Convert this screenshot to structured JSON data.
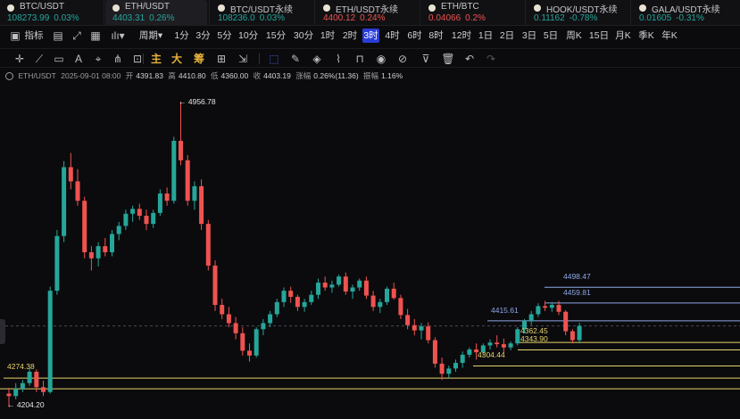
{
  "tickers": [
    {
      "name": "BTC/USDT",
      "price": "108273.99",
      "change": "0.03%",
      "dir": "up"
    },
    {
      "name": "ETH/USDT",
      "price": "4403.31",
      "change": "0.26%",
      "dir": "up",
      "active": true
    },
    {
      "name": "BTC/USDT永续",
      "price": "108236.0",
      "change": "0.03%",
      "dir": "up"
    },
    {
      "name": "ETH/USDT永续",
      "price": "4400.12",
      "change": "0.24%",
      "dir": "down"
    },
    {
      "name": "ETH/BTC",
      "price": "0.04066",
      "change": "0.2%",
      "dir": "down"
    },
    {
      "name": "HOOK/USDT永续",
      "price": "0.11162",
      "change": "-0.78%",
      "dir": "up"
    },
    {
      "name": "GALA/USDT永续",
      "price": "0.01605",
      "change": "-0.31%",
      "dir": "up"
    }
  ],
  "toolbar": {
    "indicator_label": "指标",
    "period_label": "周期",
    "periods": [
      "1分",
      "3分",
      "5分",
      "10分",
      "15分",
      "30分",
      "1时",
      "2时",
      "3时",
      "4时",
      "6时",
      "8时",
      "12时",
      "1日",
      "2日",
      "3日",
      "5日",
      "周K",
      "15日",
      "月K",
      "季K",
      "年K"
    ],
    "selected_period": "3时"
  },
  "drawing_toolbar": {
    "main_label": "主",
    "big_label": "大",
    "chips_label": "筹"
  },
  "info": {
    "symbol": "ETH/USDT",
    "time": "2025-09-01 08:00",
    "open_label": "开",
    "open": "4391.83",
    "high_label": "高",
    "high": "4410.80",
    "low_label": "低",
    "low": "4360.00",
    "close_label": "收",
    "close": "4403.19",
    "change_label": "涨幅",
    "change": "0.26%(11.36)",
    "amplitude_label": "振幅",
    "amplitude": "1.16%"
  },
  "chart_labels": {
    "high_marker": "← 4956.78",
    "low_marker": "← 4204.20",
    "levels": [
      "4498.47",
      "4459.81",
      "4415.61",
      "4362.45",
      "4343.90",
      "4304.44",
      "4274.38"
    ]
  },
  "chart_data": {
    "type": "candlestick",
    "price_max": 4956.78,
    "price_min": 4204.2,
    "candles": [
      [
        4236,
        4250,
        4204.2,
        4230
      ],
      [
        4230,
        4262,
        4222,
        4248
      ],
      [
        4248,
        4270,
        4240,
        4262
      ],
      [
        4262,
        4300,
        4255,
        4290
      ],
      [
        4290,
        4296,
        4240,
        4252
      ],
      [
        4252,
        4268,
        4230,
        4240
      ],
      [
        4240,
        4500,
        4236,
        4490
      ],
      [
        4490,
        4640,
        4480,
        4625
      ],
      [
        4625,
        4810,
        4610,
        4795
      ],
      [
        4795,
        4830,
        4740,
        4760
      ],
      [
        4760,
        4790,
        4700,
        4712
      ],
      [
        4712,
        4722,
        4570,
        4585
      ],
      [
        4585,
        4600,
        4540,
        4570
      ],
      [
        4570,
        4610,
        4550,
        4600
      ],
      [
        4600,
        4620,
        4575,
        4585
      ],
      [
        4585,
        4640,
        4575,
        4630
      ],
      [
        4630,
        4660,
        4615,
        4650
      ],
      [
        4650,
        4690,
        4640,
        4680
      ],
      [
        4680,
        4700,
        4660,
        4692
      ],
      [
        4692,
        4705,
        4665,
        4675
      ],
      [
        4675,
        4690,
        4640,
        4655
      ],
      [
        4655,
        4690,
        4645,
        4682
      ],
      [
        4682,
        4740,
        4675,
        4730
      ],
      [
        4730,
        4745,
        4700,
        4712
      ],
      [
        4712,
        4870,
        4705,
        4860
      ],
      [
        4860,
        4956.78,
        4800,
        4812
      ],
      [
        4812,
        4825,
        4700,
        4712
      ],
      [
        4712,
        4760,
        4690,
        4748
      ],
      [
        4748,
        4765,
        4640,
        4655
      ],
      [
        4655,
        4665,
        4540,
        4552
      ],
      [
        4552,
        4565,
        4440,
        4455
      ],
      [
        4455,
        4470,
        4420,
        4432
      ],
      [
        4432,
        4450,
        4400,
        4410
      ],
      [
        4410,
        4425,
        4370,
        4385
      ],
      [
        4385,
        4400,
        4330,
        4342
      ],
      [
        4342,
        4360,
        4315,
        4330
      ],
      [
        4330,
        4400,
        4325,
        4395
      ],
      [
        4395,
        4420,
        4380,
        4410
      ],
      [
        4410,
        4440,
        4400,
        4432
      ],
      [
        4432,
        4470,
        4425,
        4462
      ],
      [
        4462,
        4498,
        4450,
        4490
      ],
      [
        4490,
        4500,
        4460,
        4475
      ],
      [
        4475,
        4480,
        4440,
        4450
      ],
      [
        4450,
        4470,
        4438,
        4462
      ],
      [
        4462,
        4490,
        4455,
        4480
      ],
      [
        4480,
        4520,
        4470,
        4510
      ],
      [
        4510,
        4525,
        4490,
        4498
      ],
      [
        4498,
        4515,
        4485,
        4505
      ],
      [
        4505,
        4530,
        4500,
        4525
      ],
      [
        4525,
        4535,
        4480,
        4488
      ],
      [
        4488,
        4505,
        4470,
        4498
      ],
      [
        4498,
        4520,
        4490,
        4515
      ],
      [
        4515,
        4525,
        4470,
        4478
      ],
      [
        4478,
        4490,
        4440,
        4450
      ],
      [
        4450,
        4470,
        4435,
        4462
      ],
      [
        4462,
        4500,
        4455,
        4495
      ],
      [
        4495,
        4510,
        4468,
        4472
      ],
      [
        4472,
        4480,
        4420,
        4430
      ],
      [
        4430,
        4445,
        4395,
        4405
      ],
      [
        4405,
        4420,
        4380,
        4392
      ],
      [
        4392,
        4410,
        4370,
        4402
      ],
      [
        4402,
        4412,
        4360,
        4368
      ],
      [
        4368,
        4375,
        4300,
        4310
      ],
      [
        4310,
        4325,
        4270,
        4285
      ],
      [
        4285,
        4305,
        4275,
        4298
      ],
      [
        4298,
        4320,
        4290,
        4312
      ],
      [
        4312,
        4340,
        4300,
        4332
      ],
      [
        4332,
        4350,
        4325,
        4345
      ],
      [
        4345,
        4360,
        4320,
        4338
      ],
      [
        4338,
        4360,
        4330,
        4355
      ],
      [
        4355,
        4370,
        4345,
        4362
      ],
      [
        4362,
        4380,
        4350,
        4358
      ],
      [
        4358,
        4372,
        4338,
        4350
      ],
      [
        4350,
        4365,
        4343,
        4360
      ],
      [
        4360,
        4400,
        4355,
        4395
      ],
      [
        4395,
        4420,
        4385,
        4415
      ],
      [
        4415,
        4440,
        4405,
        4432
      ],
      [
        4432,
        4459,
        4425,
        4452
      ],
      [
        4452,
        4465,
        4440,
        4448
      ],
      [
        4448,
        4462,
        4438,
        4455
      ],
      [
        4455,
        4465,
        4430,
        4438
      ],
      [
        4438,
        4442,
        4380,
        4390
      ],
      [
        4390,
        4395,
        4360,
        4368
      ],
      [
        4368,
        4410.8,
        4360,
        4403.19
      ]
    ]
  },
  "colors": {
    "up": "#26a69a",
    "down": "#ef5350",
    "accent": "#2b3dd8",
    "level_yellow": "#e6d36a",
    "level_blue": "#8fa7e6"
  }
}
